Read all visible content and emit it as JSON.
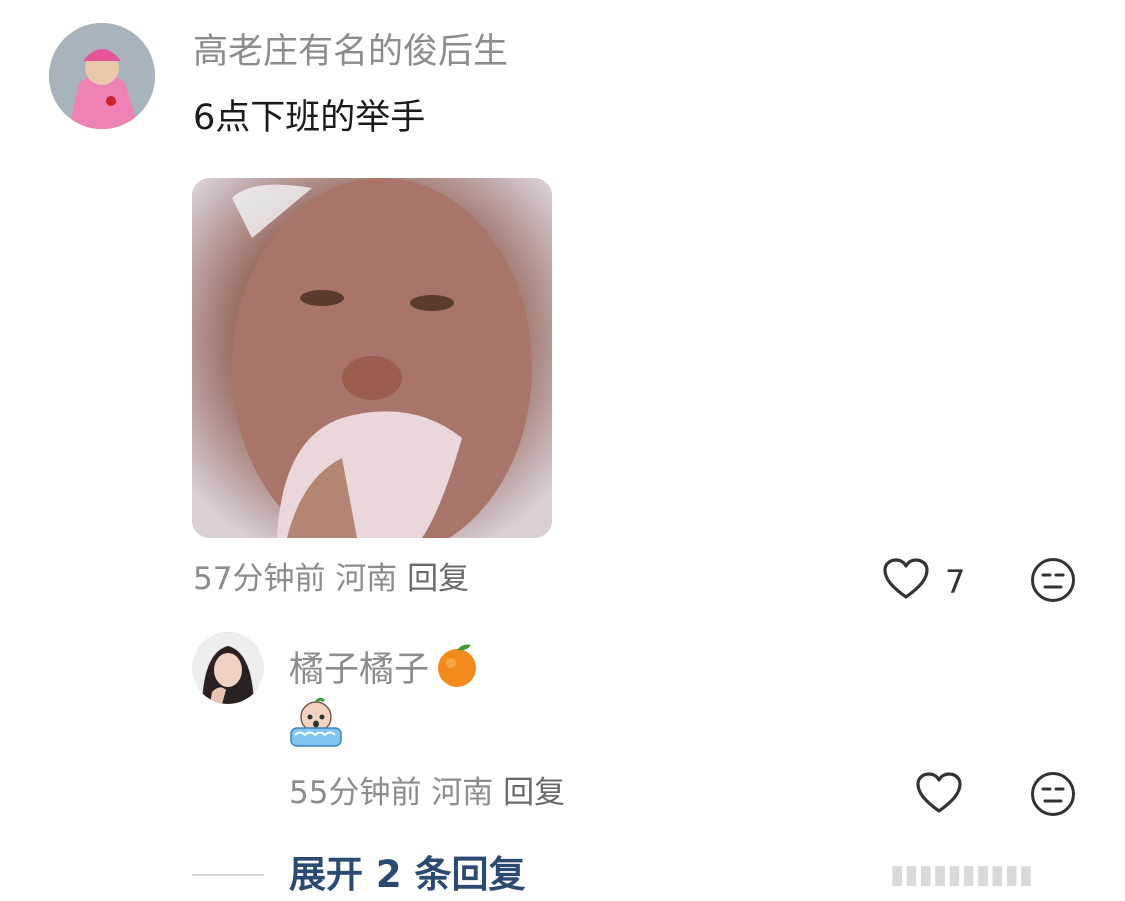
{
  "comment": {
    "username": "高老庄有名的俊后生",
    "text": "6点下班的举手",
    "time": "57分钟前",
    "location": "河南",
    "reply_label": "回复",
    "like_count": "7"
  },
  "reply": {
    "username": "橘子橘子",
    "username_emoji": "🍊",
    "emoji_icon": "crying-face-emoji-icon",
    "time": "55分钟前",
    "location": "河南",
    "reply_label": "回复"
  },
  "expand_label": "展开 2 条回复",
  "watermark": "▮▮▮▮▮▮▮▮▮▮"
}
